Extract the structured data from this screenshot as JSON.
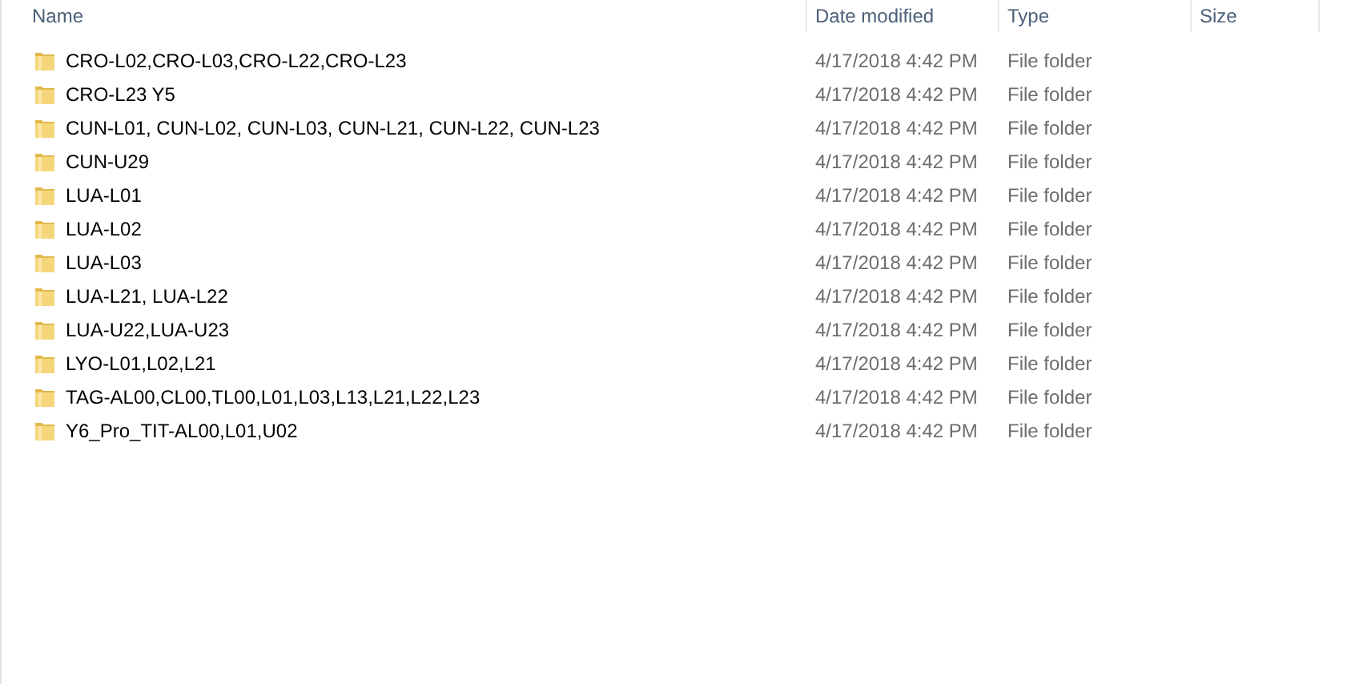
{
  "columns": [
    "Name",
    "Date modified",
    "Type",
    "Size"
  ],
  "rows": [
    {
      "name": "CRO-L02,CRO-L03,CRO-L22,CRO-L23",
      "date": "4/17/2018 4:42 PM",
      "type": "File folder"
    },
    {
      "name": "CRO-L23 Y5",
      "date": "4/17/2018 4:42 PM",
      "type": "File folder"
    },
    {
      "name": "CUN-L01, CUN-L02, CUN-L03, CUN-L21, CUN-L22, CUN-L23",
      "date": "4/17/2018 4:42 PM",
      "type": "File folder"
    },
    {
      "name": "CUN-U29",
      "date": "4/17/2018 4:42 PM",
      "type": "File folder"
    },
    {
      "name": "LUA-L01",
      "date": "4/17/2018 4:42 PM",
      "type": "File folder"
    },
    {
      "name": "LUA-L02",
      "date": "4/17/2018 4:42 PM",
      "type": "File folder"
    },
    {
      "name": "LUA-L03",
      "date": "4/17/2018 4:42 PM",
      "type": "File folder"
    },
    {
      "name": "LUA-L21, LUA-L22",
      "date": "4/17/2018 4:42 PM",
      "type": "File folder"
    },
    {
      "name": "LUA-U22,LUA-U23",
      "date": "4/17/2018 4:42 PM",
      "type": "File folder"
    },
    {
      "name": "LYO-L01,L02,L21",
      "date": "4/17/2018 4:42 PM",
      "type": "File folder"
    },
    {
      "name": "TAG-AL00,CL00,TL00,L01,L03,L13,L21,L22,L23",
      "date": "4/17/2018 4:42 PM",
      "type": "File folder"
    },
    {
      "name": "Y6_Pro_TIT-AL00,L01,U02",
      "date": "4/17/2018 4:42 PM",
      "type": "File folder"
    }
  ]
}
